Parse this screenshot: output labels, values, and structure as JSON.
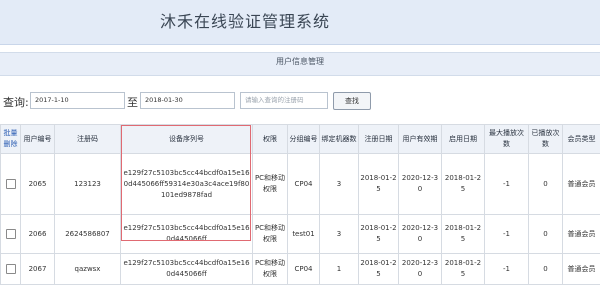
{
  "header": {
    "title": "沐禾在线验证管理系统"
  },
  "section": {
    "title": "用户信息管理"
  },
  "query": {
    "label": "查询:",
    "start_date": "2017-1-10",
    "to_label": "至",
    "end_date": "2018-01-30",
    "code_placeholder": "请输入查询的注册码",
    "search_button": "查找"
  },
  "table": {
    "headers": {
      "batch_delete": "批量删除",
      "user_id": "用户编号",
      "reg_code": "注册码",
      "device_serial": "设备序列号",
      "permission": "权限",
      "group_id": "分组编号",
      "bound_machines": "绑定机器数",
      "reg_date": "注册日期",
      "valid_until": "用户有效期",
      "enable_date": "启用日期",
      "max_plays": "最大播放次数",
      "played": "已播放次数",
      "member_type": "会员类型"
    },
    "rows": [
      {
        "user_id": "2065",
        "reg_code": "123123",
        "device_serial": "e129f27c5103bc5cc44bcdf0a15e160d445066ff59314e30a3c4ace19f80101ed9878fad",
        "permission": "PC和移动权限",
        "group_id": "CP04",
        "bound_machines": "3",
        "reg_date": "2018-01-25",
        "valid_until": "2020-12-30",
        "enable_date": "2018-01-25",
        "max_plays": "-1",
        "played": "0",
        "member_type": "普通会员"
      },
      {
        "user_id": "2066",
        "reg_code": "2624586807",
        "device_serial": "e129f27c5103bc5cc44bcdf0a15e160d445066ff",
        "permission": "PC和移动权限",
        "group_id": "test01",
        "bound_machines": "3",
        "reg_date": "2018-01-25",
        "valid_until": "2020-12-30",
        "enable_date": "2018-01-25",
        "max_plays": "-1",
        "played": "0",
        "member_type": "普通会员"
      },
      {
        "user_id": "2067",
        "reg_code": "qazwsx",
        "device_serial": "e129f27c5103bc5cc44bcdf0a15e160d445066ff",
        "permission": "PC和移动权限",
        "group_id": "CP04",
        "bound_machines": "1",
        "reg_date": "2018-01-25",
        "valid_until": "2020-12-30",
        "enable_date": "2018-01-25",
        "max_plays": "-1",
        "played": "0",
        "member_type": "普通会员"
      }
    ]
  },
  "colors": {
    "highlight": "#e06a72",
    "header_bg": "#e3ebf7",
    "link": "#2b5db3"
  }
}
